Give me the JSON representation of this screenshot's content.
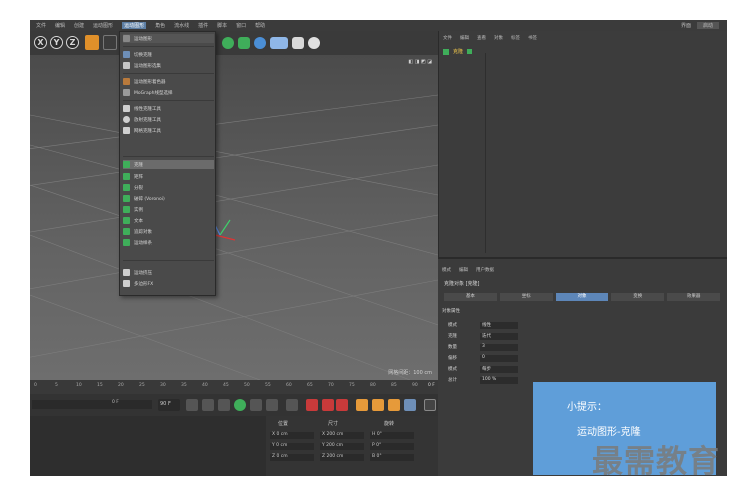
{
  "menubar": {
    "items": [
      "文件",
      "编辑",
      "创建",
      "运动图形",
      "运动图形",
      "角色",
      "流水线",
      "插件",
      "脚本",
      "窗口",
      "帮助"
    ],
    "active_index": 4,
    "right": [
      "界面",
      "启动"
    ]
  },
  "toolbar": {
    "x": "X",
    "y": "Y",
    "z": "Z"
  },
  "dropdown": {
    "header": "运动图形",
    "items": [
      "切换克隆",
      "运动图形选集",
      "运动图形着色器",
      "MoGraph线型选择",
      "线性克隆工具",
      "放射克隆工具",
      "网格克隆工具",
      "克隆",
      "矩阵",
      "分裂",
      "破碎 (Voronoi)",
      "实例",
      "文本",
      "追踪对象",
      "运动样条",
      "运动挤压",
      "多边形FX"
    ],
    "highlight_index": 7
  },
  "viewport": {
    "status": "网格间距：100 cm"
  },
  "timeline": {
    "ticks": [
      "0",
      "5",
      "10",
      "15",
      "20",
      "25",
      "30",
      "35",
      "40",
      "45",
      "50",
      "55",
      "60",
      "65",
      "70",
      "75",
      "80",
      "85",
      "90"
    ],
    "end": "0 F"
  },
  "playbar": {
    "frame_start": "0 F",
    "frame_end": "90 F"
  },
  "coords": {
    "headers": [
      "位置",
      "尺寸",
      "旋转"
    ],
    "rows": [
      [
        "X  0 cm",
        "X  200 cm",
        "H  0°"
      ],
      [
        "Y  0 cm",
        "Y  200 cm",
        "P  0°"
      ],
      [
        "Z  0 cm",
        "Z  200 cm",
        "B  0°"
      ]
    ]
  },
  "objmgr": {
    "menu": [
      "文件",
      "编辑",
      "查看",
      "对象",
      "标签",
      "书签"
    ],
    "object": "克隆"
  },
  "attr": {
    "menu": [
      "模式",
      "编辑",
      "用户数据"
    ],
    "object": "克隆对象 [克隆]",
    "tabs": [
      "基本",
      "坐标",
      "对象",
      "变换",
      "效果器"
    ],
    "active_tab": 2,
    "section": "对象属性",
    "rows": [
      {
        "label": "模式",
        "value": "线性"
      },
      {
        "label": "克隆",
        "value": "迭代"
      },
      {
        "label": "数量",
        "value": "3"
      },
      {
        "label": "偏移",
        "value": "0"
      },
      {
        "label": "模式",
        "value": "每步"
      },
      {
        "label": "总计",
        "value": "100 %"
      }
    ]
  },
  "tip": {
    "title": "小提示：",
    "text": "运动图形-克隆"
  },
  "watermark": "最需教育",
  "colors": {
    "accent": "#5d86b8",
    "tip_bg": "#5f9ed9",
    "object_yellow": "#f2c94c"
  }
}
